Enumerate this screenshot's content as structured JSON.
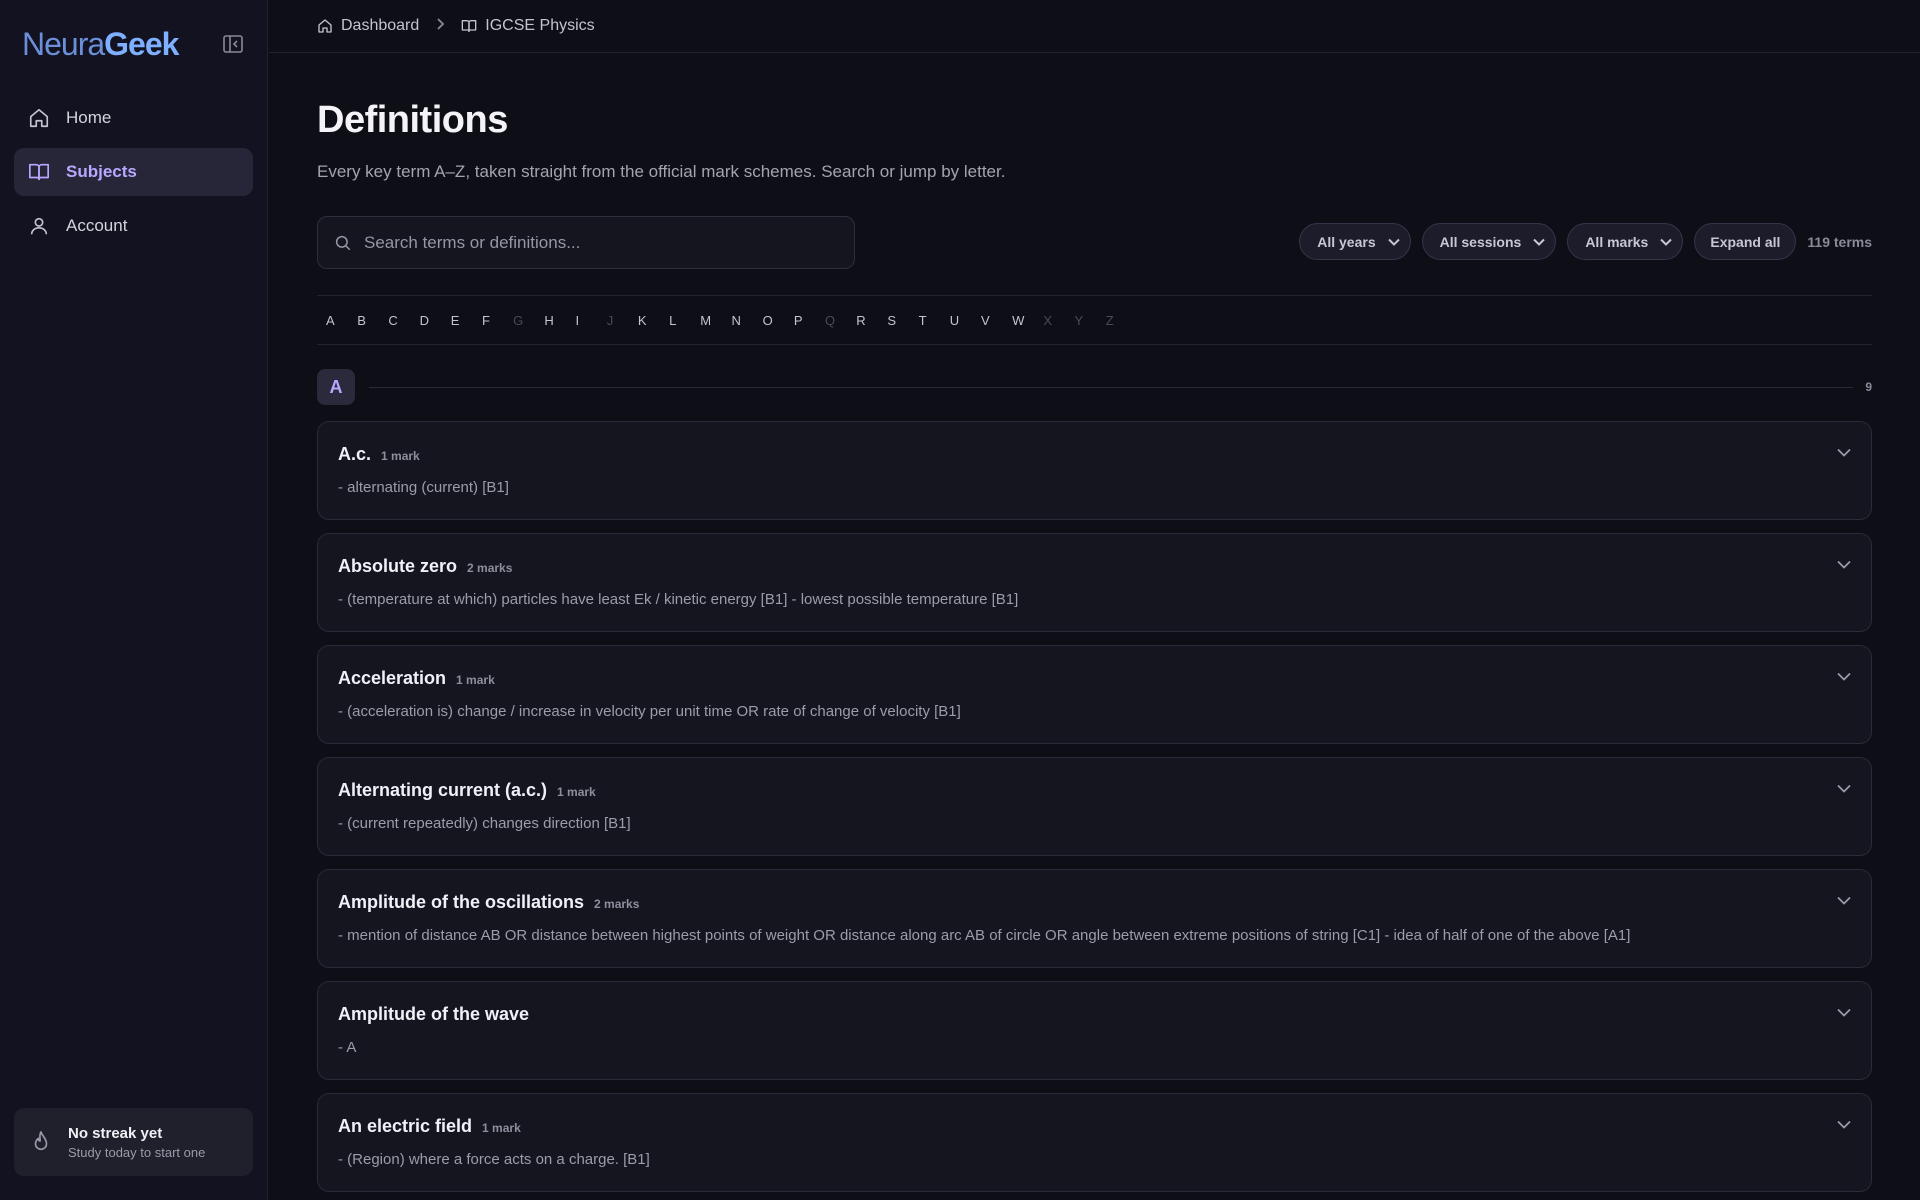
{
  "brand": {
    "part1": "Neura",
    "part2": "Geek"
  },
  "nav": [
    {
      "label": "Home",
      "icon": "home-icon"
    },
    {
      "label": "Subjects",
      "icon": "book-icon",
      "active": true
    },
    {
      "label": "Account",
      "icon": "user-icon"
    }
  ],
  "streak": {
    "title": "No streak yet",
    "subtitle": "Study today to start one"
  },
  "breadcrumb": [
    {
      "label": "Dashboard",
      "icon": "home-icon"
    },
    {
      "label": "IGCSE Physics",
      "icon": "book-icon"
    }
  ],
  "page": {
    "title": "Definitions",
    "subtitle": "Every key term A–Z, taken straight from the official mark schemes. Search or jump by letter."
  },
  "search": {
    "placeholder": "Search terms or definitions..."
  },
  "filters": {
    "years": "All years",
    "sessions": "All sessions",
    "marks": "All marks",
    "expand": "Expand all",
    "count": "119 terms"
  },
  "alphabet": [
    {
      "l": "A",
      "on": true
    },
    {
      "l": "B",
      "on": true
    },
    {
      "l": "C",
      "on": true
    },
    {
      "l": "D",
      "on": true
    },
    {
      "l": "E",
      "on": true
    },
    {
      "l": "F",
      "on": true
    },
    {
      "l": "G",
      "on": false
    },
    {
      "l": "H",
      "on": true
    },
    {
      "l": "I",
      "on": true
    },
    {
      "l": "J",
      "on": false
    },
    {
      "l": "K",
      "on": true
    },
    {
      "l": "L",
      "on": true
    },
    {
      "l": "M",
      "on": true
    },
    {
      "l": "N",
      "on": true
    },
    {
      "l": "O",
      "on": true
    },
    {
      "l": "P",
      "on": true
    },
    {
      "l": "Q",
      "on": false
    },
    {
      "l": "R",
      "on": true
    },
    {
      "l": "S",
      "on": true
    },
    {
      "l": "T",
      "on": true
    },
    {
      "l": "U",
      "on": true
    },
    {
      "l": "V",
      "on": true
    },
    {
      "l": "W",
      "on": true
    },
    {
      "l": "X",
      "on": false
    },
    {
      "l": "Y",
      "on": false
    },
    {
      "l": "Z",
      "on": false
    }
  ],
  "section": {
    "letter": "A",
    "count": "9"
  },
  "definitions": [
    {
      "term": "A.c.",
      "marks": "1 mark",
      "def": "- alternating (current) [B1]"
    },
    {
      "term": "Absolute zero",
      "marks": "2 marks",
      "def": "- (temperature at which) particles have least Ek / kinetic energy [B1] - lowest possible temperature [B1]"
    },
    {
      "term": "Acceleration",
      "marks": "1 mark",
      "def": "- (acceleration is) change / increase in velocity per unit time OR rate of change of velocity [B1]"
    },
    {
      "term": "Alternating current (a.c.)",
      "marks": "1 mark",
      "def": "- (current repeatedly) changes direction [B1]"
    },
    {
      "term": "Amplitude of the oscillations",
      "marks": "2 marks",
      "def": "- mention of distance AB OR distance between highest points of weight OR distance along arc AB of circle OR angle between extreme positions of string [C1] - idea of half of one of the above [A1]"
    },
    {
      "term": "Amplitude of the wave",
      "marks": "",
      "def": "- A"
    },
    {
      "term": "An electric field",
      "marks": "1 mark",
      "def": "- (Region) where a force acts on a charge. [B1]"
    }
  ],
  "colors": {
    "background": "#0e0e16",
    "accent": "#b9a8ff",
    "brand": "#7eb0ff"
  }
}
